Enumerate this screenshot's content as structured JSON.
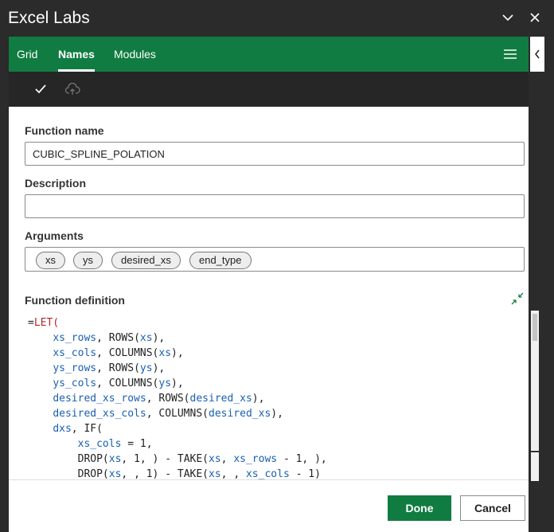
{
  "window": {
    "title": "Excel Labs"
  },
  "colors": {
    "accent": "#107c41",
    "code_identifier": "#1a5fb4",
    "code_keyword": "#b02a2a"
  },
  "icons": {
    "minimize": "chevron-down-icon",
    "close": "close-icon",
    "collapse": "chevron-left-icon",
    "menu": "hamburger-icon",
    "confirm": "checkmark-icon",
    "cloud": "cloud-upload-icon",
    "expand": "expand-icon"
  },
  "tabs": [
    {
      "label": "Grid",
      "active": false
    },
    {
      "label": "Names",
      "active": true
    },
    {
      "label": "Modules",
      "active": false
    }
  ],
  "form": {
    "function_name_label": "Function name",
    "function_name_value": "CUBIC_SPLINE_POLATION",
    "description_label": "Description",
    "description_value": "",
    "arguments_label": "Arguments",
    "arguments": [
      "xs",
      "ys",
      "desired_xs",
      "end_type"
    ],
    "definition_label": "Function definition"
  },
  "code_lines": [
    [
      {
        "t": "=",
        "c": "p"
      },
      {
        "t": "LET(",
        "c": "k"
      }
    ],
    [
      {
        "t": "    ",
        "c": "p"
      },
      {
        "t": "xs_rows",
        "c": "i"
      },
      {
        "t": ", ",
        "c": "p"
      },
      {
        "t": "ROWS(",
        "c": "f"
      },
      {
        "t": "xs",
        "c": "i"
      },
      {
        "t": "),",
        "c": "f"
      }
    ],
    [
      {
        "t": "    ",
        "c": "p"
      },
      {
        "t": "xs_cols",
        "c": "i"
      },
      {
        "t": ", ",
        "c": "p"
      },
      {
        "t": "COLUMNS(",
        "c": "f"
      },
      {
        "t": "xs",
        "c": "i"
      },
      {
        "t": "),",
        "c": "f"
      }
    ],
    [
      {
        "t": "    ",
        "c": "p"
      },
      {
        "t": "ys_rows",
        "c": "i"
      },
      {
        "t": ", ",
        "c": "p"
      },
      {
        "t": "ROWS(",
        "c": "f"
      },
      {
        "t": "ys",
        "c": "i"
      },
      {
        "t": "),",
        "c": "f"
      }
    ],
    [
      {
        "t": "    ",
        "c": "p"
      },
      {
        "t": "ys_cols",
        "c": "i"
      },
      {
        "t": ", ",
        "c": "p"
      },
      {
        "t": "COLUMNS(",
        "c": "f"
      },
      {
        "t": "ys",
        "c": "i"
      },
      {
        "t": "),",
        "c": "f"
      }
    ],
    [
      {
        "t": "    ",
        "c": "p"
      },
      {
        "t": "desired_xs_rows",
        "c": "i"
      },
      {
        "t": ", ",
        "c": "p"
      },
      {
        "t": "ROWS(",
        "c": "f"
      },
      {
        "t": "desired_xs",
        "c": "i"
      },
      {
        "t": "),",
        "c": "f"
      }
    ],
    [
      {
        "t": "    ",
        "c": "p"
      },
      {
        "t": "desired_xs_cols",
        "c": "i"
      },
      {
        "t": ", ",
        "c": "p"
      },
      {
        "t": "COLUMNS(",
        "c": "f"
      },
      {
        "t": "desired_xs",
        "c": "i"
      },
      {
        "t": "),",
        "c": "f"
      }
    ],
    [
      {
        "t": "    ",
        "c": "p"
      },
      {
        "t": "dxs",
        "c": "i"
      },
      {
        "t": ", ",
        "c": "p"
      },
      {
        "t": "IF(",
        "c": "f"
      }
    ],
    [
      {
        "t": "        ",
        "c": "p"
      },
      {
        "t": "xs_cols",
        "c": "i"
      },
      {
        "t": " = 1,",
        "c": "p"
      }
    ],
    [
      {
        "t": "        ",
        "c": "p"
      },
      {
        "t": "DROP(",
        "c": "f"
      },
      {
        "t": "xs",
        "c": "i"
      },
      {
        "t": ", 1, ) - ",
        "c": "p"
      },
      {
        "t": "TAKE(",
        "c": "f"
      },
      {
        "t": "xs",
        "c": "i"
      },
      {
        "t": ", ",
        "c": "p"
      },
      {
        "t": "xs_rows",
        "c": "i"
      },
      {
        "t": " - 1, ),",
        "c": "p"
      }
    ],
    [
      {
        "t": "        ",
        "c": "p"
      },
      {
        "t": "DROP(",
        "c": "f"
      },
      {
        "t": "xs",
        "c": "i"
      },
      {
        "t": ", , 1) - ",
        "c": "p"
      },
      {
        "t": "TAKE(",
        "c": "f"
      },
      {
        "t": "xs",
        "c": "i"
      },
      {
        "t": ", , ",
        "c": "p"
      },
      {
        "t": "xs_cols",
        "c": "i"
      },
      {
        "t": " - 1)",
        "c": "p"
      }
    ]
  ],
  "footer": {
    "done_label": "Done",
    "cancel_label": "Cancel"
  }
}
